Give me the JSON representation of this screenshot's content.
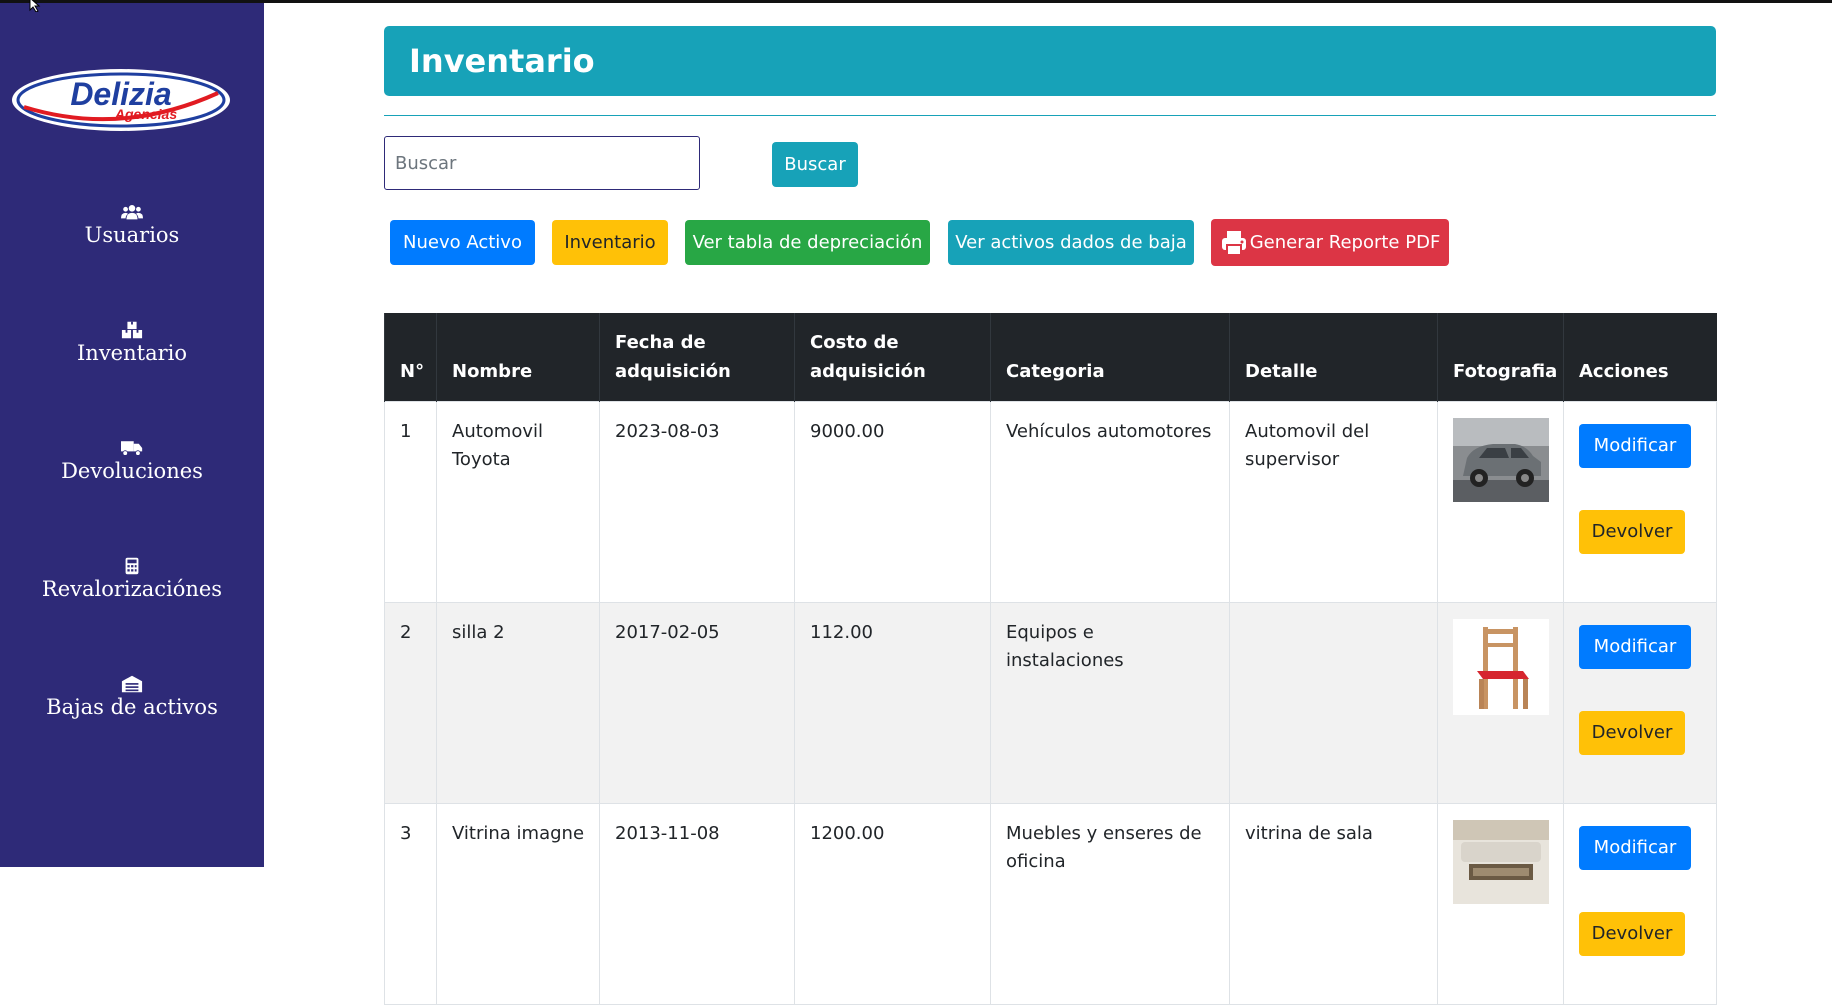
{
  "sidebar": {
    "logo_text": "Delizia",
    "logo_subtext": "Agencias",
    "items": [
      {
        "label": "Usuarios",
        "icon": "users-icon"
      },
      {
        "label": "Inventario",
        "icon": "boxes-icon"
      },
      {
        "label": "Devoluciones",
        "icon": "truck-icon"
      },
      {
        "label": "Revalorizaciónes",
        "icon": "calculator-icon"
      },
      {
        "label": "Bajas de activos",
        "icon": "warehouse-icon"
      }
    ]
  },
  "header": {
    "title": "Inventario"
  },
  "search": {
    "placeholder": "Buscar",
    "value": "",
    "button_label": "Buscar"
  },
  "toolbar": {
    "new_asset": "Nuevo Activo",
    "inventory": "Inventario",
    "depreciation": "Ver tabla de depreciación",
    "written_off": "Ver activos dados de baja",
    "pdf_report": "Generar Reporte PDF"
  },
  "table": {
    "headers": {
      "num": "N°",
      "name": "Nombre",
      "date_1": "Fecha de",
      "date_2": "adquisición",
      "cost_1": "Costo de",
      "cost_2": "adquisición",
      "category": "Categoria",
      "detail": "Detalle",
      "photo": "Fotografia",
      "actions": "Acciones"
    },
    "rows": [
      {
        "num": "1",
        "name": "Automovil Toyota",
        "date": "2023-08-03",
        "cost": "9000.00",
        "category": "Vehículos automotores",
        "detail": "Automovil del supervisor",
        "photo": "car-photo"
      },
      {
        "num": "2",
        "name": "silla 2",
        "date": "2017-02-05",
        "cost": "112.00",
        "category": "Equipos e instalaciones",
        "detail": "",
        "photo": "chair-photo"
      },
      {
        "num": "3",
        "name": "Vitrina imagne",
        "date": "2013-11-08",
        "cost": "1200.00",
        "category": "Muebles y enseres de oficina",
        "detail": "vitrina de sala",
        "photo": "showcase-photo"
      }
    ],
    "modify_label": "Modificar",
    "return_label": "Devolver"
  },
  "colors": {
    "sidebar": "#2e2a78",
    "info": "#17a2b8",
    "primary": "#007bff",
    "warning": "#ffc107",
    "success": "#28a745",
    "danger": "#dc3545",
    "table_header": "#212529"
  }
}
